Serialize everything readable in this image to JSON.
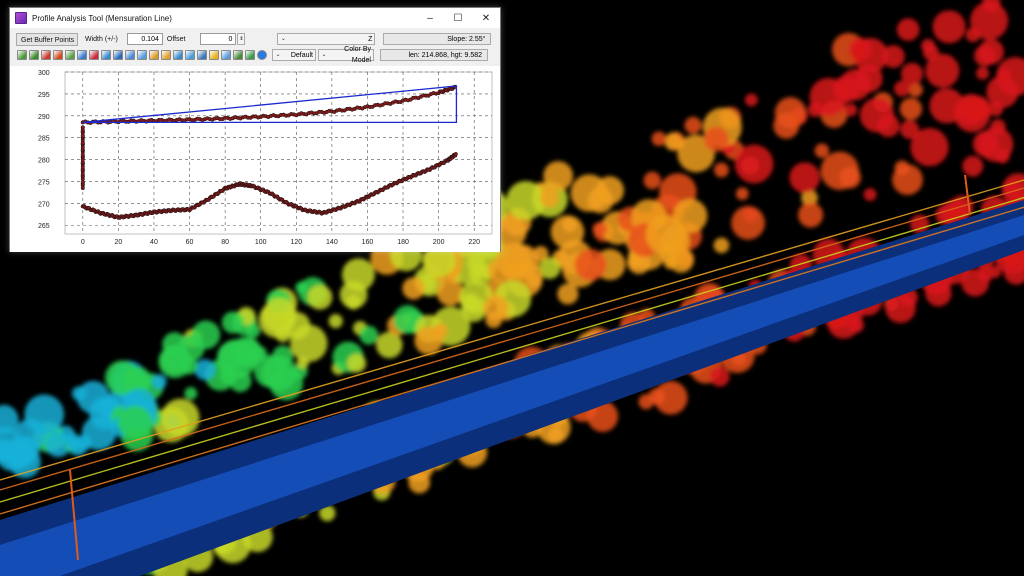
{
  "window": {
    "title": "Profile Analysis Tool (Mensuration Line)",
    "controls": {
      "minimize": "–",
      "maximize": "☐",
      "close": "✕"
    }
  },
  "toolbar_row1": {
    "get_buffer_points": "Get Buffer Points",
    "width_label": "Width (+/-)",
    "width_value": "0.104",
    "offset_label": "Offset",
    "offset_value": "0",
    "axis_combo": "Z",
    "slope": "Slope:  2.55°"
  },
  "toolbar_row2": {
    "style_combo": "Default",
    "color_combo": "Color By Model",
    "len_hgt": "len: 214.868, hgt: 9.582"
  },
  "toolbar_icons": [
    {
      "name": "open-icon",
      "color": "#4a9a3a"
    },
    {
      "name": "add-icon",
      "color": "#3a8a2a"
    },
    {
      "name": "chart-icon",
      "color": "#c83a2a"
    },
    {
      "name": "brush-icon",
      "color": "#d24a1a"
    },
    {
      "name": "link-icon",
      "color": "#5aa04a"
    },
    {
      "name": "ruler-icon",
      "color": "#3a7ac8"
    },
    {
      "name": "stamp-icon",
      "color": "#c8283a"
    },
    {
      "name": "zoom-in-icon",
      "color": "#3a8ac8"
    },
    {
      "name": "expand-icon",
      "color": "#2a6ab8"
    },
    {
      "name": "zoom-icon",
      "color": "#4a8ad8"
    },
    {
      "name": "pan-icon",
      "color": "#5a9ad8"
    },
    {
      "name": "measure-icon",
      "color": "#d89a2a"
    },
    {
      "name": "select-icon",
      "color": "#e0a030"
    },
    {
      "name": "grid-icon",
      "color": "#3a8ac8"
    },
    {
      "name": "table-icon",
      "color": "#4a9ad8"
    },
    {
      "name": "layers-icon",
      "color": "#3a7ab8"
    },
    {
      "name": "export-icon",
      "color": "#e8b020"
    },
    {
      "name": "pen-icon",
      "color": "#5a9ad8"
    },
    {
      "name": "tool-icon",
      "color": "#4a8a3a"
    },
    {
      "name": "settings-icon",
      "color": "#3a9a4a"
    },
    {
      "name": "help-icon",
      "color": "#2a7ae0"
    }
  ],
  "chart_data": {
    "type": "scatter",
    "xlim": [
      -10,
      230
    ],
    "ylim": [
      263,
      300
    ],
    "x_ticks": [
      "0",
      "20",
      "40",
      "60",
      "80",
      "100",
      "120",
      "140",
      "160",
      "180",
      "200",
      "220"
    ],
    "y_ticks": [
      "265",
      "270",
      "275",
      "280",
      "285",
      "290",
      "295",
      "300"
    ],
    "grid": true,
    "series": [
      {
        "kind": "upper_profile",
        "points": [
          [
            0,
            288.5
          ],
          [
            20,
            288.7
          ],
          [
            40,
            288.9
          ],
          [
            60,
            289.1
          ],
          [
            80,
            289.4
          ],
          [
            100,
            289.8
          ],
          [
            120,
            290.3
          ],
          [
            140,
            291.0
          ],
          [
            160,
            292.0
          ],
          [
            180,
            293.4
          ],
          [
            200,
            295.3
          ],
          [
            210,
            296.6
          ]
        ]
      },
      {
        "kind": "ground_profile",
        "points": [
          [
            0,
            269.3
          ],
          [
            10,
            267.8
          ],
          [
            20,
            266.8
          ],
          [
            30,
            267.3
          ],
          [
            40,
            268.0
          ],
          [
            50,
            268.4
          ],
          [
            60,
            268.6
          ],
          [
            70,
            270.8
          ],
          [
            80,
            273.4
          ],
          [
            88,
            274.4
          ],
          [
            95,
            274.0
          ],
          [
            105,
            272.4
          ],
          [
            115,
            270.0
          ],
          [
            125,
            268.4
          ],
          [
            135,
            267.8
          ],
          [
            145,
            269.0
          ],
          [
            155,
            270.5
          ],
          [
            165,
            272.5
          ],
          [
            175,
            274.5
          ],
          [
            185,
            276.2
          ],
          [
            195,
            277.8
          ],
          [
            205,
            279.8
          ],
          [
            210,
            281.3
          ]
        ]
      },
      {
        "kind": "vertical_stack",
        "points": [
          [
            0,
            273.5
          ],
          [
            0,
            276
          ],
          [
            0,
            278
          ],
          [
            0,
            280
          ],
          [
            0,
            282
          ],
          [
            0,
            284
          ],
          [
            0,
            286
          ],
          [
            0,
            287.5
          ]
        ]
      }
    ],
    "overlay_triangle": [
      [
        0,
        288.5
      ],
      [
        210,
        288.5
      ],
      [
        210,
        296.8
      ]
    ],
    "colors": {
      "points": "#8a1a1a",
      "outline": "#111111",
      "overlay": "#1a2ad0"
    }
  }
}
